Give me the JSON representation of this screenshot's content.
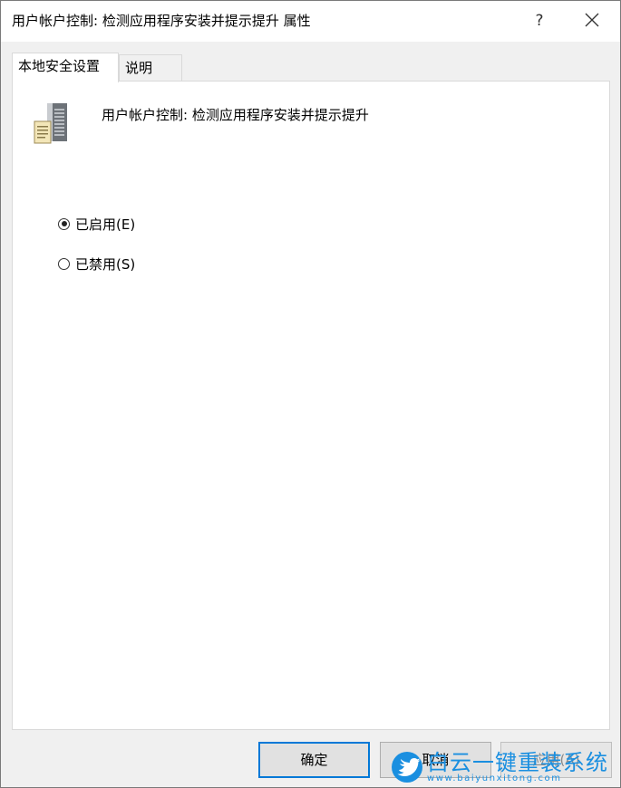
{
  "window": {
    "title": "用户帐户控制: 检测应用程序安装并提示提升 属性",
    "help_label": "?"
  },
  "tabs": [
    {
      "label": "本地安全设置",
      "active": true
    },
    {
      "label": "说明",
      "active": false
    }
  ],
  "policy": {
    "name": "用户帐户控制: 检测应用程序安装并提示提升",
    "icon": "server-policy-icon"
  },
  "options": [
    {
      "label": "已启用(E)",
      "checked": true
    },
    {
      "label": "已禁用(S)",
      "checked": false
    }
  ],
  "buttons": {
    "ok_label": "确定",
    "cancel_label": "取消",
    "apply_label": "应用(A)"
  },
  "watermark": {
    "text": "白云一键重装系统",
    "url": "www.baiyunxitong.com"
  },
  "colors": {
    "accent": "#0078d7",
    "watermark": "#1a8fe0"
  }
}
